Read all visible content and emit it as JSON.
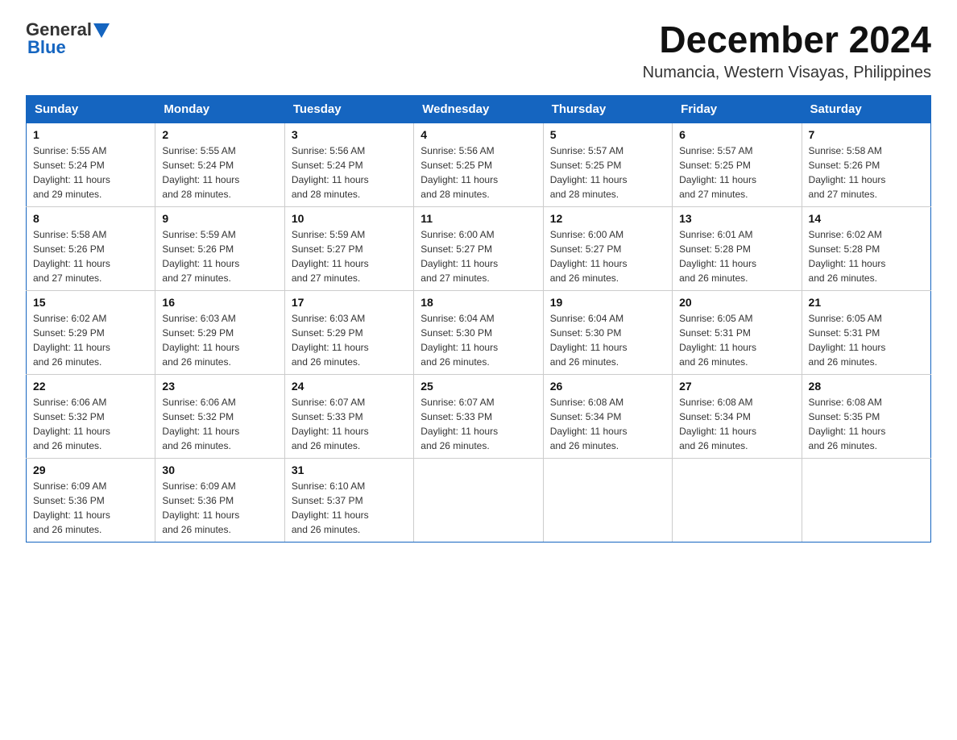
{
  "header": {
    "logo_text_general": "General",
    "logo_text_blue": "Blue",
    "main_title": "December 2024",
    "subtitle": "Numancia, Western Visayas, Philippines"
  },
  "calendar": {
    "days_of_week": [
      "Sunday",
      "Monday",
      "Tuesday",
      "Wednesday",
      "Thursday",
      "Friday",
      "Saturday"
    ],
    "weeks": [
      [
        {
          "day": "1",
          "sunrise": "5:55 AM",
          "sunset": "5:24 PM",
          "daylight": "11 hours and 29 minutes."
        },
        {
          "day": "2",
          "sunrise": "5:55 AM",
          "sunset": "5:24 PM",
          "daylight": "11 hours and 28 minutes."
        },
        {
          "day": "3",
          "sunrise": "5:56 AM",
          "sunset": "5:24 PM",
          "daylight": "11 hours and 28 minutes."
        },
        {
          "day": "4",
          "sunrise": "5:56 AM",
          "sunset": "5:25 PM",
          "daylight": "11 hours and 28 minutes."
        },
        {
          "day": "5",
          "sunrise": "5:57 AM",
          "sunset": "5:25 PM",
          "daylight": "11 hours and 28 minutes."
        },
        {
          "day": "6",
          "sunrise": "5:57 AM",
          "sunset": "5:25 PM",
          "daylight": "11 hours and 27 minutes."
        },
        {
          "day": "7",
          "sunrise": "5:58 AM",
          "sunset": "5:26 PM",
          "daylight": "11 hours and 27 minutes."
        }
      ],
      [
        {
          "day": "8",
          "sunrise": "5:58 AM",
          "sunset": "5:26 PM",
          "daylight": "11 hours and 27 minutes."
        },
        {
          "day": "9",
          "sunrise": "5:59 AM",
          "sunset": "5:26 PM",
          "daylight": "11 hours and 27 minutes."
        },
        {
          "day": "10",
          "sunrise": "5:59 AM",
          "sunset": "5:27 PM",
          "daylight": "11 hours and 27 minutes."
        },
        {
          "day": "11",
          "sunrise": "6:00 AM",
          "sunset": "5:27 PM",
          "daylight": "11 hours and 27 minutes."
        },
        {
          "day": "12",
          "sunrise": "6:00 AM",
          "sunset": "5:27 PM",
          "daylight": "11 hours and 26 minutes."
        },
        {
          "day": "13",
          "sunrise": "6:01 AM",
          "sunset": "5:28 PM",
          "daylight": "11 hours and 26 minutes."
        },
        {
          "day": "14",
          "sunrise": "6:02 AM",
          "sunset": "5:28 PM",
          "daylight": "11 hours and 26 minutes."
        }
      ],
      [
        {
          "day": "15",
          "sunrise": "6:02 AM",
          "sunset": "5:29 PM",
          "daylight": "11 hours and 26 minutes."
        },
        {
          "day": "16",
          "sunrise": "6:03 AM",
          "sunset": "5:29 PM",
          "daylight": "11 hours and 26 minutes."
        },
        {
          "day": "17",
          "sunrise": "6:03 AM",
          "sunset": "5:29 PM",
          "daylight": "11 hours and 26 minutes."
        },
        {
          "day": "18",
          "sunrise": "6:04 AM",
          "sunset": "5:30 PM",
          "daylight": "11 hours and 26 minutes."
        },
        {
          "day": "19",
          "sunrise": "6:04 AM",
          "sunset": "5:30 PM",
          "daylight": "11 hours and 26 minutes."
        },
        {
          "day": "20",
          "sunrise": "6:05 AM",
          "sunset": "5:31 PM",
          "daylight": "11 hours and 26 minutes."
        },
        {
          "day": "21",
          "sunrise": "6:05 AM",
          "sunset": "5:31 PM",
          "daylight": "11 hours and 26 minutes."
        }
      ],
      [
        {
          "day": "22",
          "sunrise": "6:06 AM",
          "sunset": "5:32 PM",
          "daylight": "11 hours and 26 minutes."
        },
        {
          "day": "23",
          "sunrise": "6:06 AM",
          "sunset": "5:32 PM",
          "daylight": "11 hours and 26 minutes."
        },
        {
          "day": "24",
          "sunrise": "6:07 AM",
          "sunset": "5:33 PM",
          "daylight": "11 hours and 26 minutes."
        },
        {
          "day": "25",
          "sunrise": "6:07 AM",
          "sunset": "5:33 PM",
          "daylight": "11 hours and 26 minutes."
        },
        {
          "day": "26",
          "sunrise": "6:08 AM",
          "sunset": "5:34 PM",
          "daylight": "11 hours and 26 minutes."
        },
        {
          "day": "27",
          "sunrise": "6:08 AM",
          "sunset": "5:34 PM",
          "daylight": "11 hours and 26 minutes."
        },
        {
          "day": "28",
          "sunrise": "6:08 AM",
          "sunset": "5:35 PM",
          "daylight": "11 hours and 26 minutes."
        }
      ],
      [
        {
          "day": "29",
          "sunrise": "6:09 AM",
          "sunset": "5:36 PM",
          "daylight": "11 hours and 26 minutes."
        },
        {
          "day": "30",
          "sunrise": "6:09 AM",
          "sunset": "5:36 PM",
          "daylight": "11 hours and 26 minutes."
        },
        {
          "day": "31",
          "sunrise": "6:10 AM",
          "sunset": "5:37 PM",
          "daylight": "11 hours and 26 minutes."
        },
        null,
        null,
        null,
        null
      ]
    ]
  },
  "labels": {
    "sunrise": "Sunrise:",
    "sunset": "Sunset:",
    "daylight": "Daylight:"
  }
}
